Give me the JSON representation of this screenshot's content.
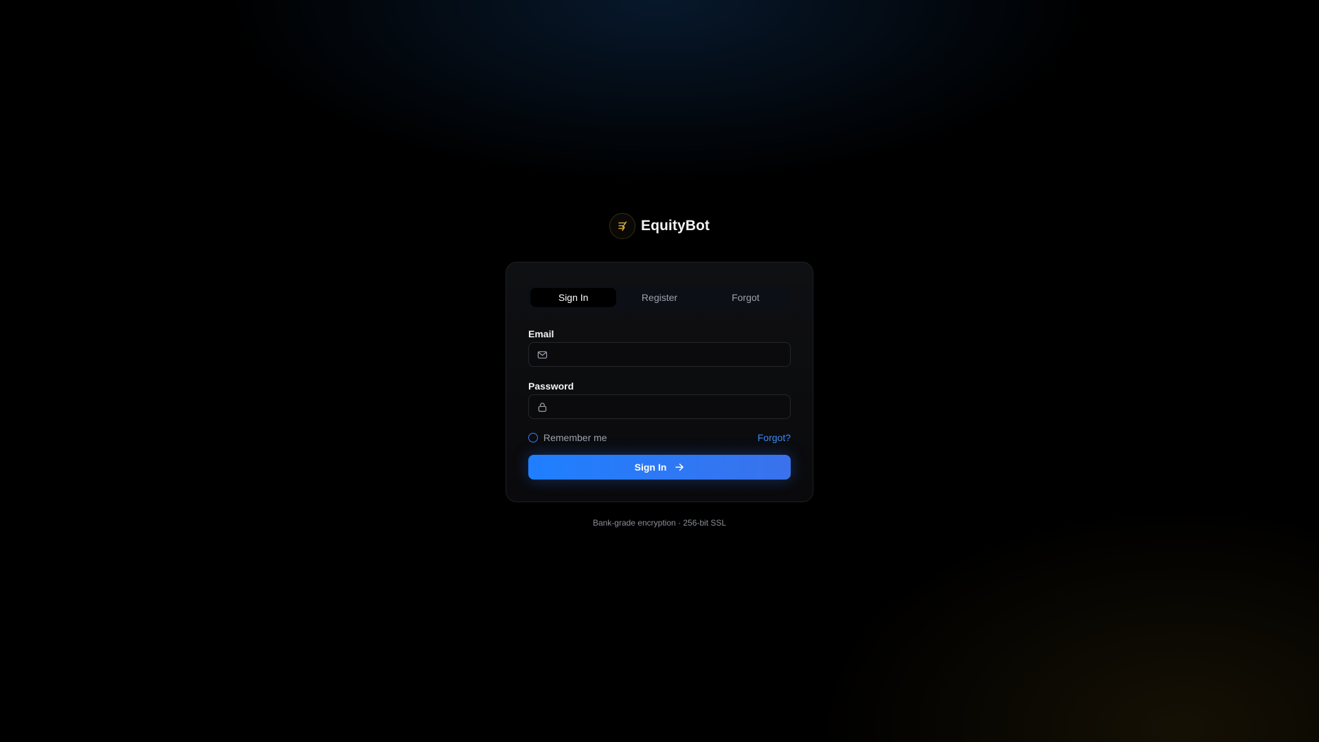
{
  "brand": {
    "name": "EquityBot",
    "logo_icon": "lightning-e-icon",
    "accent_color": "#d4a72c"
  },
  "tabs": [
    {
      "label": "Sign In",
      "active": true
    },
    {
      "label": "Register",
      "active": false
    },
    {
      "label": "Forgot",
      "active": false
    }
  ],
  "form": {
    "email": {
      "label": "Email",
      "value": "",
      "placeholder": "",
      "icon": "mail-icon"
    },
    "password": {
      "label": "Password",
      "value": "",
      "placeholder": "",
      "icon": "lock-icon"
    },
    "remember_label": "Remember me",
    "remember_checked": false,
    "forgot_link": "Forgot?",
    "submit_label": "Sign In",
    "submit_icon": "arrow-right-icon"
  },
  "footer": {
    "security_note": "Bank-grade encryption · 256-bit SSL"
  },
  "colors": {
    "primary": "#2f7bf5",
    "link": "#3b8cf6",
    "background": "#000000"
  }
}
